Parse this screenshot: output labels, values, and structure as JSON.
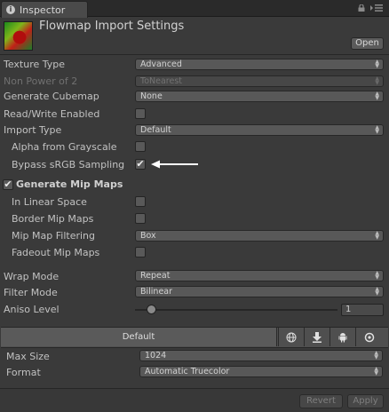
{
  "tab": {
    "label": "Inspector",
    "icon": "info-icon"
  },
  "header": {
    "title": "Flowmap Import Settings",
    "open_label": "Open"
  },
  "rows": {
    "texture_type": {
      "label": "Texture Type",
      "value": "Advanced"
    },
    "non_power_of_2": {
      "label": "Non Power of 2",
      "value": "ToNearest"
    },
    "generate_cubemap": {
      "label": "Generate Cubemap",
      "value": "None"
    },
    "read_write": {
      "label": "Read/Write Enabled"
    },
    "import_type": {
      "label": "Import Type",
      "value": "Default"
    },
    "alpha_from_grayscale": {
      "label": "Alpha from Grayscale"
    },
    "bypass_srgb": {
      "label": "Bypass sRGB Sampling",
      "checked": true
    },
    "generate_mip_maps": {
      "label": "Generate Mip Maps",
      "checked": true
    },
    "in_linear_space": {
      "label": "In Linear Space"
    },
    "border_mip_maps": {
      "label": "Border Mip Maps"
    },
    "mip_map_filtering": {
      "label": "Mip Map Filtering",
      "value": "Box"
    },
    "fadeout_mip_maps": {
      "label": "Fadeout Mip Maps"
    },
    "wrap_mode": {
      "label": "Wrap Mode",
      "value": "Repeat"
    },
    "filter_mode": {
      "label": "Filter Mode",
      "value": "Bilinear"
    },
    "aniso_level": {
      "label": "Aniso Level",
      "value": "1",
      "slider_fraction": 0.06
    }
  },
  "platform": {
    "default_label": "Default",
    "icons": [
      "globe-icon",
      "download-icon",
      "android-icon",
      "circle-icon"
    ]
  },
  "platform_settings": {
    "max_size": {
      "label": "Max Size",
      "value": "1024"
    },
    "format": {
      "label": "Format",
      "value": "Automatic Truecolor"
    }
  },
  "footer": {
    "revert_label": "Revert",
    "apply_label": "Apply"
  },
  "checkmark": "✔"
}
